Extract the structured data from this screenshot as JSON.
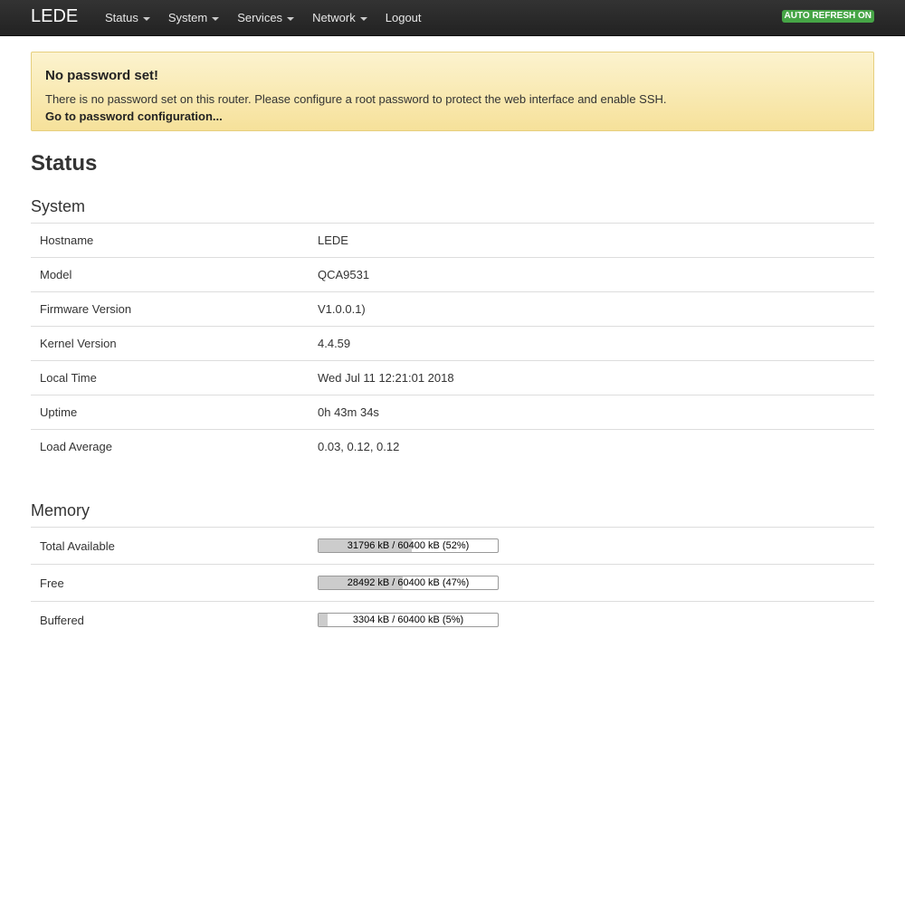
{
  "navbar": {
    "brand": "LEDE",
    "menu": [
      {
        "label": "Status",
        "dropdown": true
      },
      {
        "label": "System",
        "dropdown": true
      },
      {
        "label": "Services",
        "dropdown": true
      },
      {
        "label": "Network",
        "dropdown": true
      },
      {
        "label": "Logout",
        "dropdown": false
      }
    ],
    "refresh_badge": "AUTO REFRESH ON"
  },
  "alert": {
    "title": "No password set!",
    "text": "There is no password set on this router. Please configure a root password to protect the web interface and enable SSH.",
    "link": "Go to password configuration..."
  },
  "page_title": "Status",
  "system": {
    "title": "System",
    "rows": [
      {
        "label": "Hostname",
        "value": "LEDE"
      },
      {
        "label": "Model",
        "value": "QCA9531"
      },
      {
        "label": "Firmware Version",
        "value": "V1.0.0.1)"
      },
      {
        "label": "Kernel Version",
        "value": "4.4.59"
      },
      {
        "label": "Local Time",
        "value": "Wed Jul 11 12:21:01 2018"
      },
      {
        "label": "Uptime",
        "value": "0h 43m 34s"
      },
      {
        "label": "Load Average",
        "value": "0.03, 0.12, 0.12"
      }
    ]
  },
  "memory": {
    "title": "Memory",
    "rows": [
      {
        "label": "Total Available",
        "text": "31796 kB / 60400 kB (52%)",
        "percent": 52
      },
      {
        "label": "Free",
        "text": "28492 kB / 60400 kB (47%)",
        "percent": 47
      },
      {
        "label": "Buffered",
        "text": "3304 kB / 60400 kB (5%)",
        "percent": 5
      }
    ]
  },
  "colors": {
    "navbar_bg": "#222222",
    "alert_bg": "#f6e19a",
    "badge_green": "#46a546",
    "progress_fill": "#cccccc"
  }
}
